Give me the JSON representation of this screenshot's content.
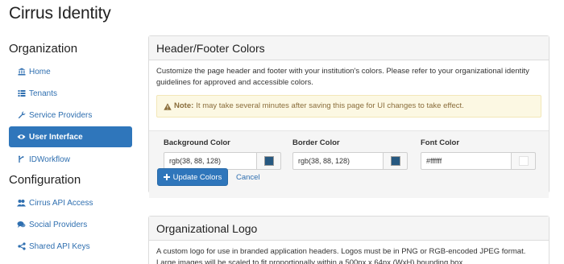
{
  "app": {
    "title": "Cirrus Identity"
  },
  "sidebar": {
    "organization_title": "Organization",
    "organization_items": [
      {
        "label": "Home",
        "icon": "bank-icon"
      },
      {
        "label": "Tenants",
        "icon": "list-icon"
      },
      {
        "label": "Service Providers",
        "icon": "wrench-icon"
      },
      {
        "label": "User Interface",
        "icon": "eye-icon",
        "active": true
      },
      {
        "label": "IDWorkflow",
        "icon": "workflow-icon"
      }
    ],
    "configuration_title": "Configuration",
    "configuration_items": [
      {
        "label": "Cirrus API Access",
        "icon": "users-icon"
      },
      {
        "label": "Social Providers",
        "icon": "comments-icon"
      },
      {
        "label": "Shared API Keys",
        "icon": "share-icon"
      }
    ]
  },
  "header_footer": {
    "title": "Header/Footer Colors",
    "description": "Customize the page header and footer with your institution's colors. Please refer to your organizational identity guidelines for approved and accessible colors.",
    "note_label": "Note:",
    "note_text": "It may take several minutes after saving this page for UI changes to take effect.",
    "background": {
      "label": "Background Color",
      "value": "rgb(38, 88, 128)",
      "swatch": "#265880"
    },
    "border": {
      "label": "Border Color",
      "value": "rgb(38, 88, 128)",
      "swatch": "#265880"
    },
    "font": {
      "label": "Font Color",
      "value": "#ffffff",
      "swatch": "#ffffff"
    },
    "update_label": "Update Colors",
    "cancel_label": "Cancel"
  },
  "logo": {
    "title": "Organizational Logo",
    "description": "A custom logo for use in branded application headers. Logos must be in PNG or RGB-encoded JPEG format. Large images will be scaled to fit proportionally within a 500px x 64px (WxH) bounding box."
  },
  "colors": {
    "accent": "#2f76bb",
    "link": "#2f6fb0",
    "note_bg": "#fcf8e3",
    "note_text": "#8a6d3b"
  }
}
